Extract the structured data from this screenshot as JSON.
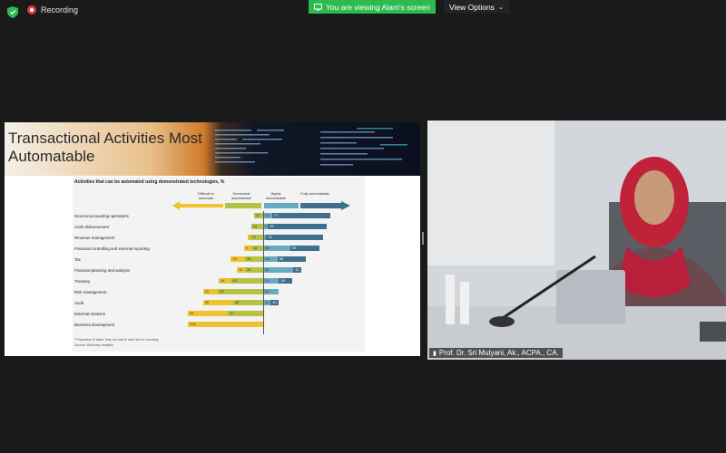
{
  "topbar": {
    "recording_label": "Recording",
    "viewing_label": "You are viewing Alam's screen",
    "view_options_label": "View Options"
  },
  "slide": {
    "title_line1": "Transactional Activities Most",
    "title_line2": "Automatable"
  },
  "chart_data": {
    "type": "bar",
    "title": "Activities that can be automated using demonstrated technologies, %",
    "legend": [
      "Difficult to automate",
      "Somewhat automatable",
      "Highly automatable",
      "Fully automatable"
    ],
    "colors": {
      "difficult": "#f0c232",
      "somewhat": "#b5c243",
      "highly": "#68aac0",
      "fully": "#3f6f8e"
    },
    "categories": [
      "General accounting operations",
      "Cash disbursement",
      "Revenue management",
      "Financial controlling and external reporting",
      "Tax",
      "Financial planning and analysis",
      "Treasury",
      "Risk management",
      "Audit",
      "External relations",
      "Business development"
    ],
    "series": [
      {
        "name": "Difficult to automate",
        "values": [
          0,
          0,
          4,
          9,
          19,
          11,
          16,
          20,
          40,
          53,
          100
        ]
      },
      {
        "name": "Somewhat automatable",
        "values": [
          12,
          16,
          17,
          16,
          24,
          24,
          43,
          60,
          40,
          47,
          0
        ]
      },
      {
        "name": "Highly automatable",
        "values": [
          12,
          6,
          4,
          36,
          19,
          40,
          21,
          20,
          10,
          0,
          0
        ]
      },
      {
        "name": "Fully automatable",
        "values": [
          77,
          78,
          75,
          39,
          38,
          11,
          18,
          0,
          10,
          0,
          0
        ]
      }
    ],
    "footnote_1": "¹ Proportion of tasks. May not add to sixth due to rounding.",
    "footnote_2": "Source: McKinsey analysis"
  },
  "speaker": {
    "name": "Prof. Dr. Sri Mulyani, Ak., ACPA., CA."
  }
}
